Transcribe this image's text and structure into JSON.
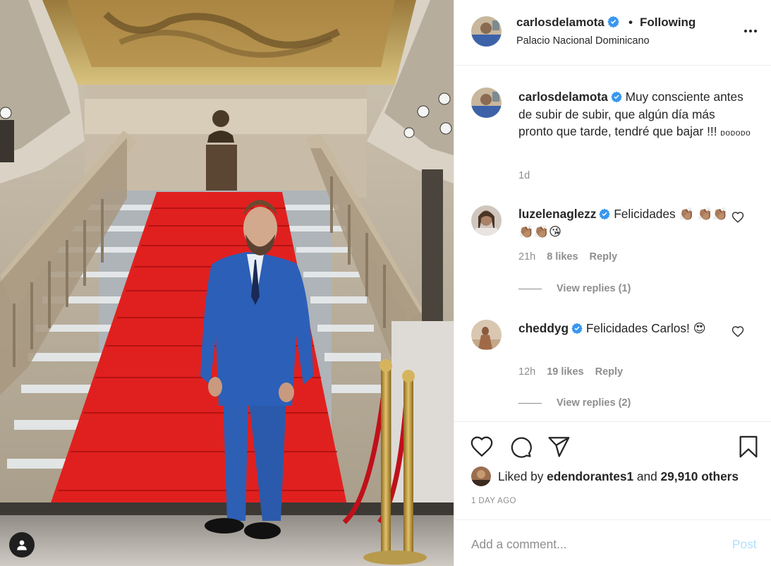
{
  "post": {
    "username": "carlosdelamota",
    "verified": true,
    "dot": "•",
    "follow_status": "Following",
    "location": "Palacio Nacional Dominicano",
    "more_options_icon": "more-horizontal-icon"
  },
  "caption": {
    "username": "carlosdelamota",
    "text": " Muy consciente antes de subir de subir, que algún día más pronto que tarde, tendré que bajar !!! ",
    "suffix": "ᴅᴏᴅᴏᴅᴏ",
    "time": "1d"
  },
  "comments": [
    {
      "username": "luzelenaglezz",
      "verified": true,
      "text": " Felicidades 👏🏽 👏🏽👏🏽👏🏽👏🏽😘",
      "time": "21h",
      "likes": "8 likes",
      "reply": "Reply",
      "view_replies": "View replies (1)"
    },
    {
      "username": "cheddyg",
      "verified": true,
      "text": " Felicidades Carlos! 😍",
      "time": "12h",
      "likes": "19 likes",
      "reply": "Reply",
      "view_replies": "View replies (2)"
    }
  ],
  "likes": {
    "prefix": "Liked by ",
    "user": "edendorantes1",
    "middle": " and ",
    "others": "29,910 others"
  },
  "date": "1 DAY AGO",
  "comment_box": {
    "placeholder": "Add a comment...",
    "post_label": "Post"
  },
  "colors": {
    "verified": "#3897f0",
    "post_disabled": "#b2dffc",
    "muted": "#8e8e8e",
    "carpet": "#e0201f",
    "suit": "#2a5cb3"
  }
}
